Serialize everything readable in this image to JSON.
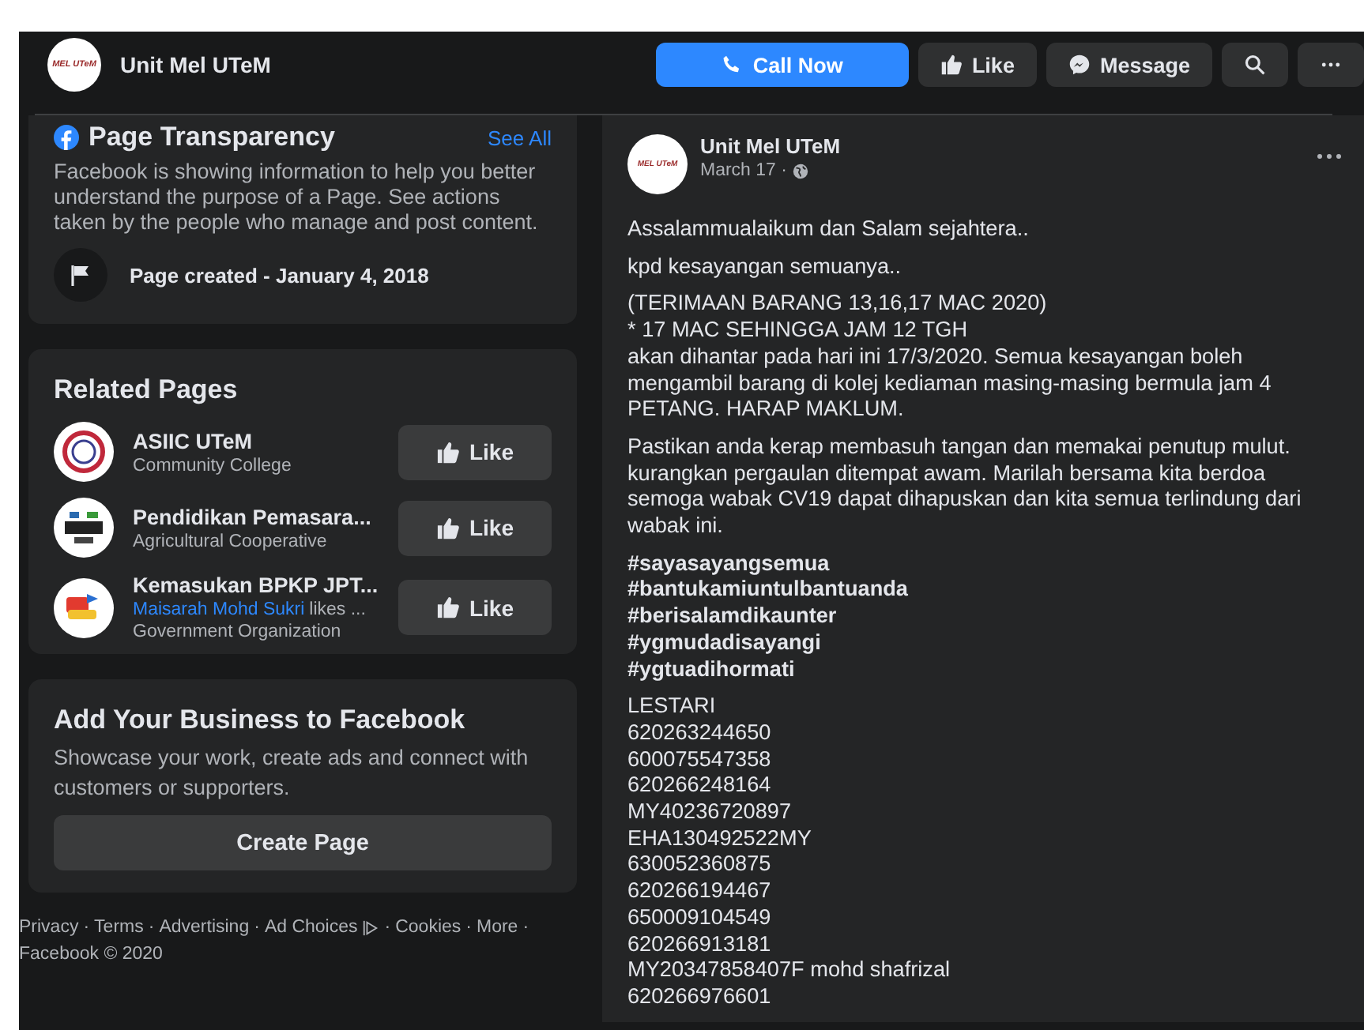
{
  "header": {
    "page_name": "Unit Mel UTeM",
    "avatar_text": "MEL UTeM",
    "buttons": [
      {
        "kind": "call",
        "label": "Call Now"
      },
      {
        "kind": "like",
        "label": "Like"
      },
      {
        "kind": "message",
        "label": "Message"
      },
      {
        "kind": "search"
      },
      {
        "kind": "more"
      }
    ]
  },
  "transparency": {
    "title": "Page Transparency",
    "see_all": "See All",
    "description": "Facebook is showing information to help you better understand the purpose of a Page. See actions taken by the people who manage and post content.",
    "created": "Page created - January 4, 2018"
  },
  "related": {
    "title": "Related Pages",
    "pages": [
      {
        "name": "ASIIC UTeM",
        "category": "Community College",
        "kind": "asiic",
        "button": "Like"
      },
      {
        "name": "Pendidikan Pemasara...",
        "category": "Agricultural Cooperative",
        "kind": "pendidikan",
        "button": "Like"
      },
      {
        "name": "Kemasukan BPKP JPT...",
        "friend": "Maisarah Mohd Sukri",
        "friend_suffix": "likes ...",
        "category": "Government Organization",
        "kind": "upu",
        "button": "Like"
      }
    ]
  },
  "business": {
    "title": "Add Your Business to Facebook",
    "text": "Showcase your work, create ads and connect with customers or supporters.",
    "button": "Create Page"
  },
  "footer": {
    "separator": "·",
    "links": [
      {
        "kind": "plain",
        "label": "Privacy"
      },
      {
        "kind": "plain",
        "label": "Terms"
      },
      {
        "kind": "plain",
        "label": "Advertising"
      },
      {
        "kind": "adchoices",
        "label": "Ad Choices"
      },
      {
        "kind": "plain",
        "label": "Cookies"
      },
      {
        "kind": "plain",
        "label": "More"
      }
    ],
    "copyright": "Facebook © 2020"
  },
  "post": {
    "author": "Unit Mel UTeM",
    "avatar_text": "MEL UTeM",
    "date": "March 17 ·",
    "paragraphs": [
      {
        "kind": "plain",
        "lines": [
          "Assalammualaikum dan Salam sejahtera.."
        ]
      },
      {
        "kind": "plain",
        "lines": [
          "kpd kesayangan semuanya.."
        ]
      },
      {
        "kind": "plain",
        "lines": [
          "(TERIMAAN BARANG 13,16,17 MAC 2020)",
          "* 17 MAC SEHINGGA JAM 12 TGH",
          "akan dihantar pada hari ini 17/3/2020. Semua kesayangan boleh mengambil barang di kolej kediaman masing-masing bermula jam 4 PETANG. HARAP MAKLUM."
        ]
      },
      {
        "kind": "plain",
        "lines": [
          "Pastikan anda kerap membasuh tangan dan memakai penutup mulut. kurangkan pergaulan ditempat awam. Marilah bersama kita berdoa semoga wabak CV19 dapat dihapuskan dan kita semua terlindung dari wabak ini."
        ]
      },
      {
        "kind": "hashtags",
        "lines": [
          "#sayasayangsemua",
          "#bantukamiuntulbantuanda",
          "#berisalamdikaunter",
          "#ygmudadisayangi",
          "#ygtuadihormati"
        ]
      },
      {
        "kind": "plain",
        "lines": [
          "LESTARI",
          "620263244650",
          "600075547358",
          "620266248164",
          "MY40236720897",
          "EHA130492522MY",
          "630052360875",
          "620266194467",
          "650009104549",
          "620266913181",
          "MY20347858407F mohd shafrizal",
          "620266976601"
        ]
      }
    ]
  }
}
